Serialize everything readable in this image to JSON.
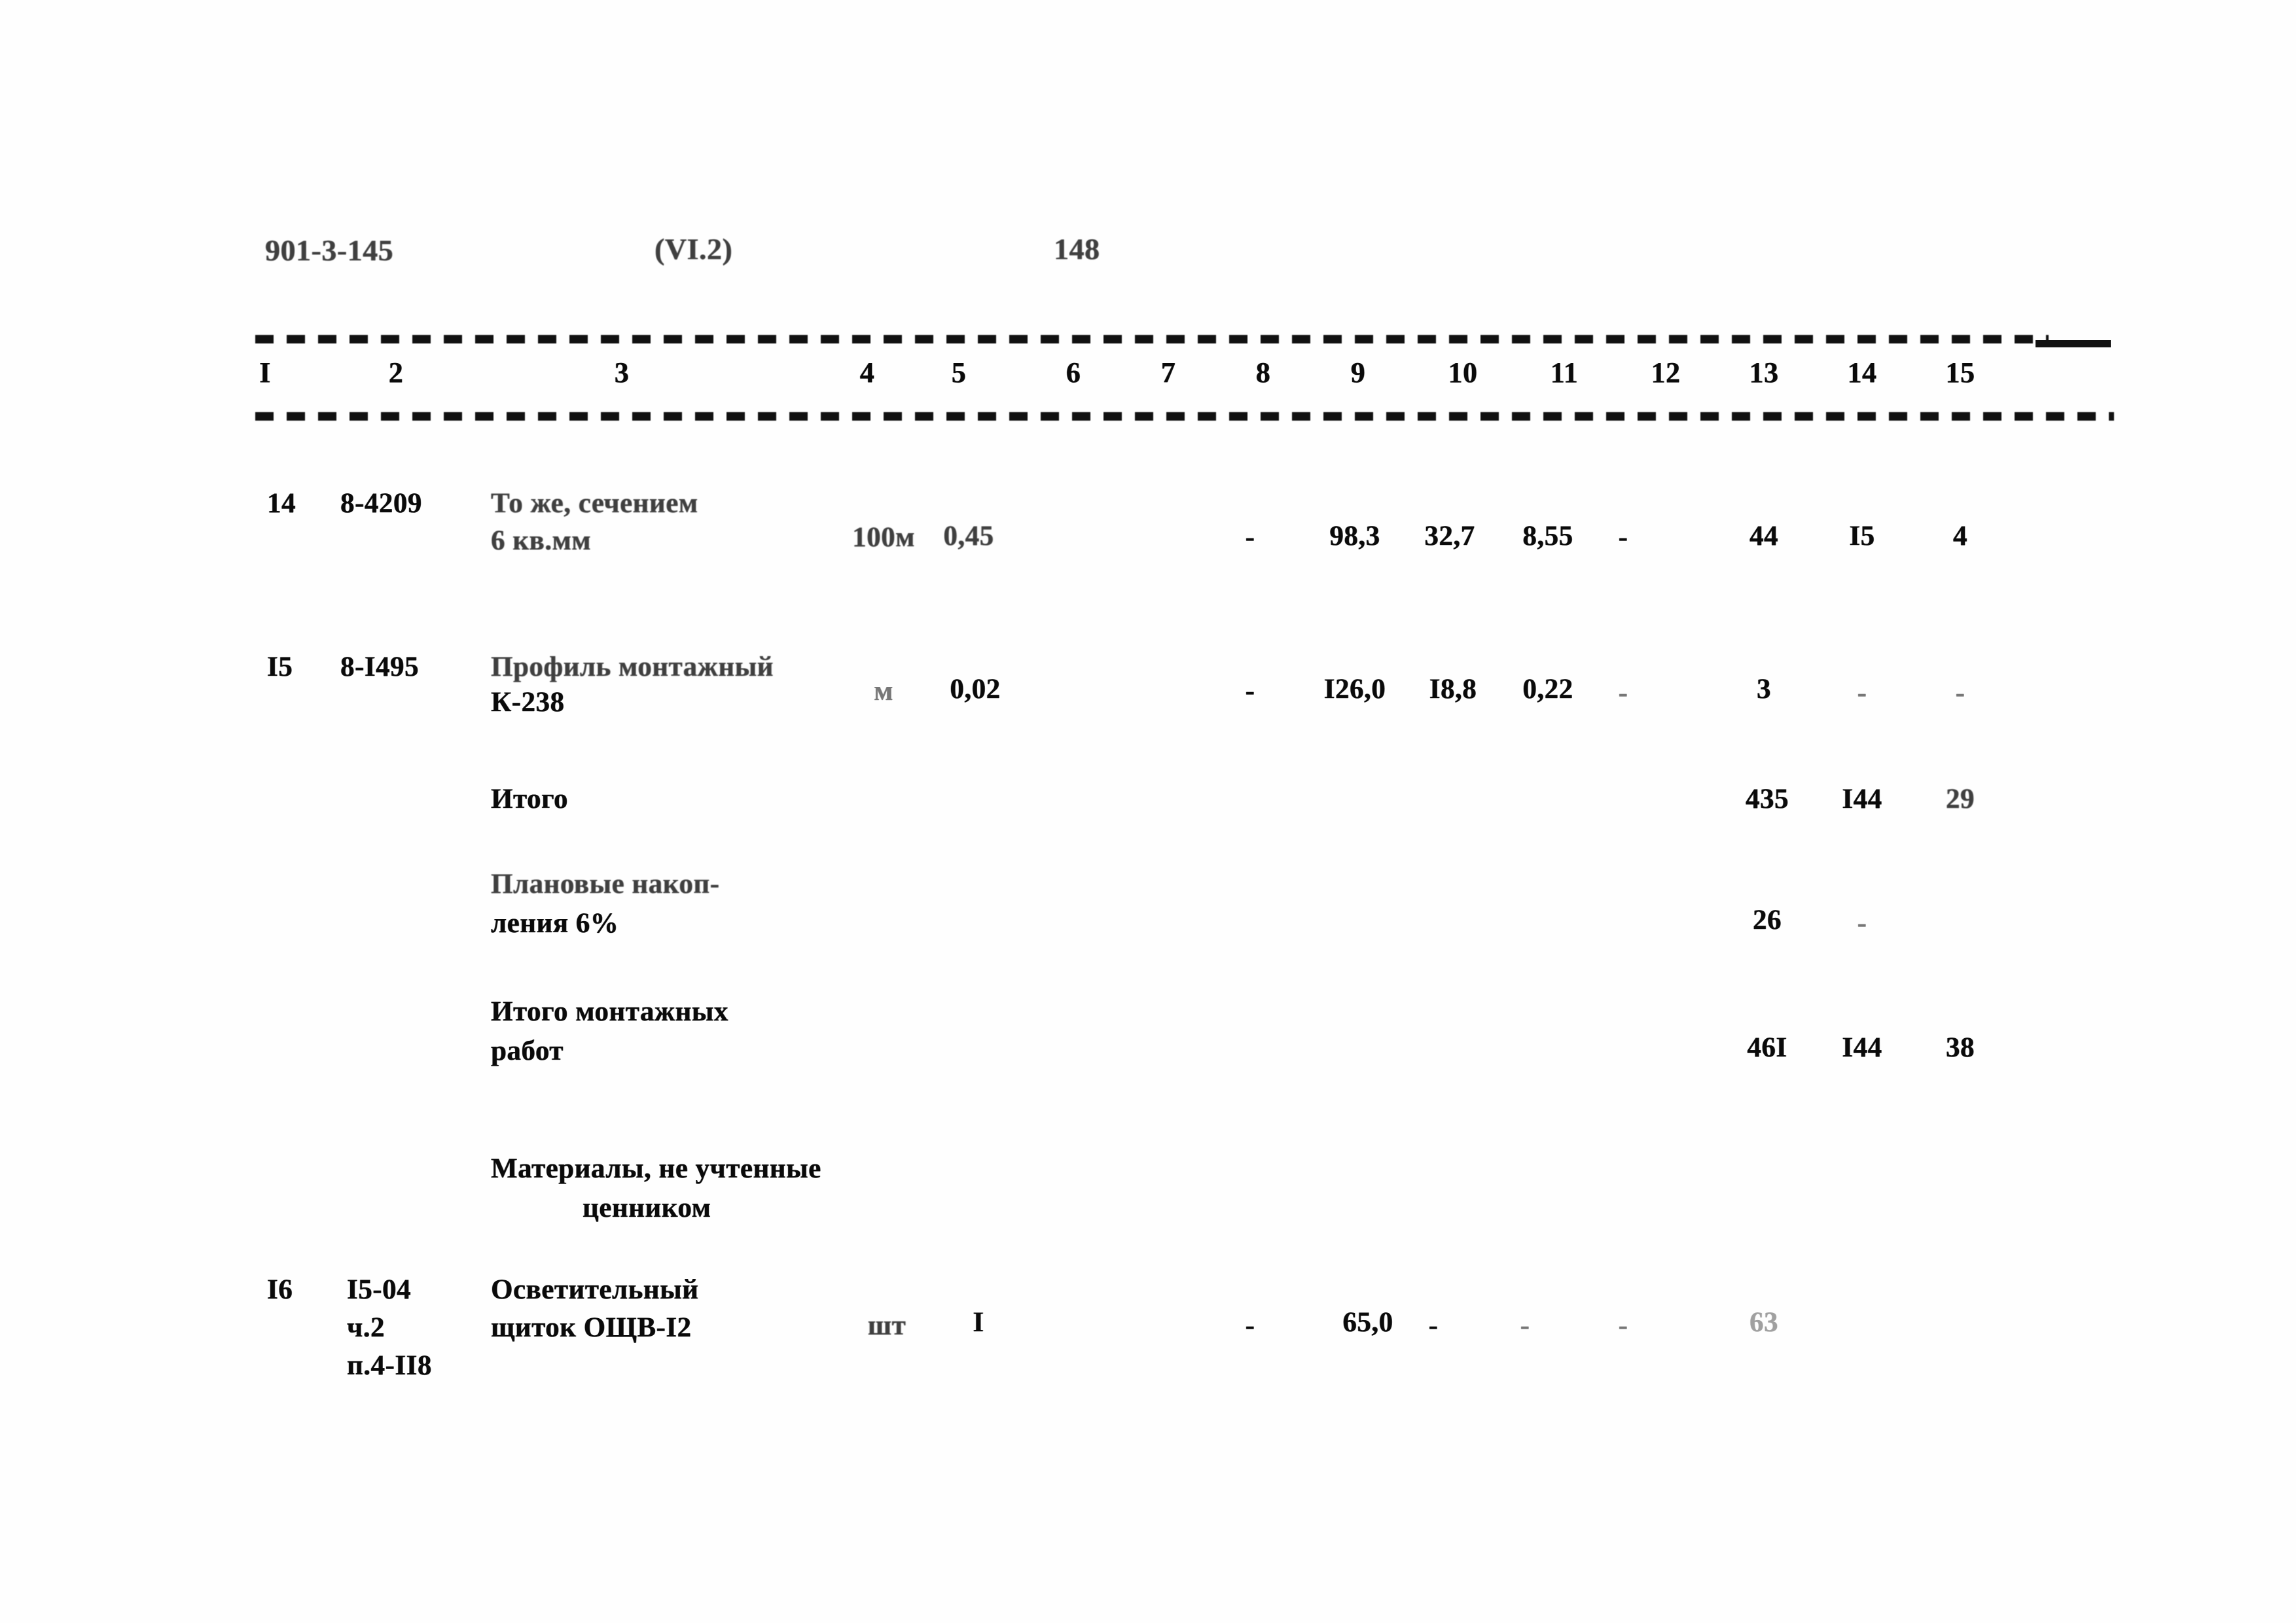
{
  "document": {
    "series_code": "901-3-145",
    "section_ref": "(VI.2)",
    "page_number": "148"
  },
  "table": {
    "column_numbers": [
      "I",
      "2",
      "3",
      "4",
      "5",
      "6",
      "7",
      "8",
      "9",
      "10",
      "11",
      "12",
      "13",
      "14",
      "15"
    ],
    "rows": [
      {
        "no": "14",
        "code": "8-4209",
        "name_line1": "То же, сечением",
        "name_line2": "6 кв.мм",
        "unit": "100м",
        "qty": "0,45",
        "c6": "",
        "c7": "",
        "c8": "-",
        "c9": "98,3",
        "c10": "32,7",
        "c11": "8,55",
        "c12": "-",
        "c13": "44",
        "c14": "I5",
        "c15": "4"
      },
      {
        "no": "I5",
        "code": "8-I495",
        "name_line1": "Профиль монтажный",
        "name_line2": "К-238",
        "unit": "м",
        "qty": "0,02",
        "c6": "",
        "c7": "",
        "c8": "-",
        "c9": "I26,0",
        "c10": "I8,8",
        "c11": "0,22",
        "c12": "-",
        "c13": "3",
        "c14": "-",
        "c15": "-"
      }
    ],
    "summaries": [
      {
        "label_line1": "Итого",
        "label_line2": "",
        "c13": "435",
        "c14": "I44",
        "c15": "29"
      },
      {
        "label_line1": "Плановые накоп-",
        "label_line2": "ления 6%",
        "c13": "26",
        "c14": "-",
        "c15": ""
      },
      {
        "label_line1": "Итого монтажных",
        "label_line2": "работ",
        "c13": "46I",
        "c14": "I44",
        "c15": "38"
      }
    ],
    "section_heading": {
      "line1": "Материалы, не учтенные",
      "line2": "ценником"
    },
    "trailing_row": {
      "no": "I6",
      "code_line1": "I5-04",
      "code_line2": "ч.2",
      "code_line3": "п.4-II8",
      "name_line1": "Осветительный",
      "name_line2": "щиток ОЩВ-I2",
      "unit": "шт",
      "qty": "I",
      "c8": "-",
      "c9": "65,0",
      "c10": "-",
      "c11": "-",
      "c12": "-",
      "c13": "63"
    }
  }
}
